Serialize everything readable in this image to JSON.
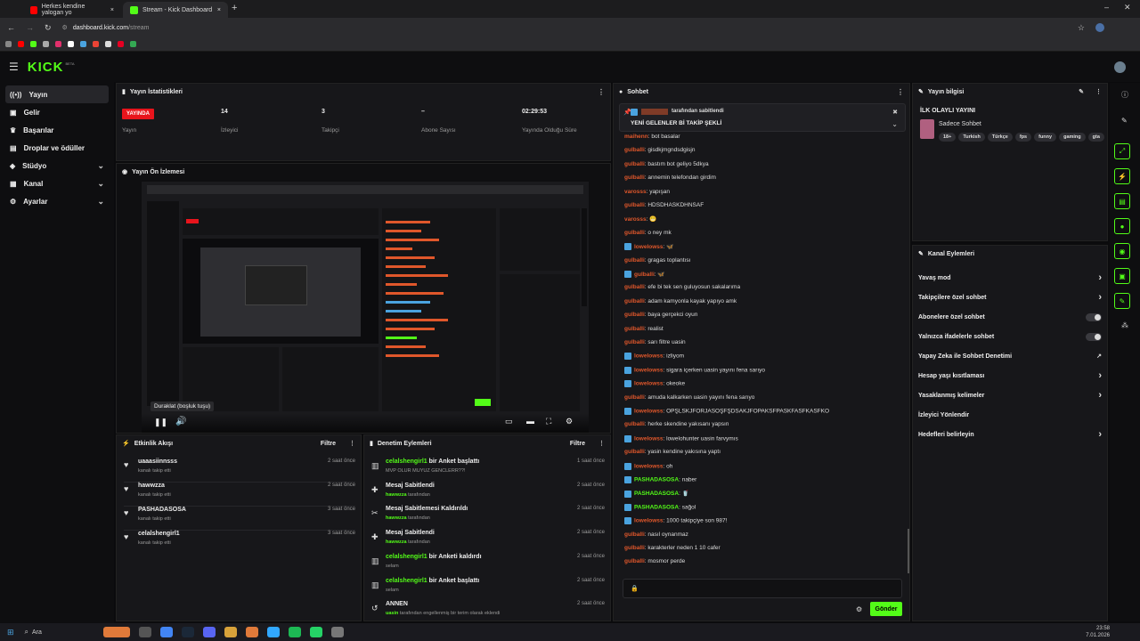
{
  "browser": {
    "tabs": [
      {
        "title": "Herkes kendine yalogan yo",
        "active": false
      },
      {
        "title": "Stream - Kick Dashboard",
        "active": true
      }
    ],
    "url_host": "dashboard.kick.com",
    "url_path": "/stream"
  },
  "app": {
    "logo": "KICK",
    "logo_tag": "BETA",
    "accent": "#53fc18",
    "live_color": "#e8141c"
  },
  "sidebar": {
    "items": [
      {
        "label": "Yayın",
        "icon": "broadcast-icon",
        "active": true,
        "expand": false
      },
      {
        "label": "Gelir",
        "icon": "wallet-icon",
        "active": false,
        "expand": false
      },
      {
        "label": "Başarılar",
        "icon": "trophy-icon",
        "active": false,
        "expand": false
      },
      {
        "label": "Droplar ve ödüller",
        "icon": "gift-icon",
        "active": false,
        "expand": false
      },
      {
        "label": "Stüdyo",
        "icon": "studio-icon",
        "active": false,
        "expand": true
      },
      {
        "label": "Kanal",
        "icon": "channel-icon",
        "active": false,
        "expand": true
      },
      {
        "label": "Ayarlar",
        "icon": "gear-icon",
        "active": false,
        "expand": true
      }
    ]
  },
  "stats": {
    "title": "Yayın İstatistikleri",
    "live_badge": "YAYINDA",
    "items": [
      {
        "value": "",
        "label": "Yayın"
      },
      {
        "value": "14",
        "label": "İzleyici"
      },
      {
        "value": "3",
        "label": "Takipçi"
      },
      {
        "value": "–",
        "label": "Abone Sayısı"
      },
      {
        "value": "02:29:53",
        "label": "Yayında Olduğu Süre"
      }
    ]
  },
  "preview": {
    "title": "Yayın Ön İzlemesi",
    "tooltip": "Duraklat (boşluk tuşu)"
  },
  "events": {
    "title": "Etkinlik Akışı",
    "filter": "Filtre",
    "items": [
      {
        "name": "uaaasiinnsss",
        "sub": "kanalı takip etti",
        "time": "2 saat önce"
      },
      {
        "name": "hawwzza",
        "sub": "kanalı takip etti",
        "time": "2 saat önce"
      },
      {
        "name": "PASHADASOSA",
        "sub": "kanalı takip etti",
        "time": "3 saat önce"
      },
      {
        "name": "celalshengirl1",
        "sub": "kanalı takip etti",
        "time": "3 saat önce"
      }
    ]
  },
  "moderation": {
    "title": "Denetim Eylemleri",
    "filter": "Filtre",
    "items": [
      {
        "icon": "poll-icon",
        "user": "celalshengirl1",
        "action": " bir Anket başlattı",
        "sub_user": "",
        "sub": "MVP OLUR MUYUZ GENCLERR??!",
        "time": "1 saat önce"
      },
      {
        "icon": "pin-icon",
        "user": "",
        "action": "Mesaj Sabitlendi",
        "sub_user": "hawwzza",
        "sub": " tarafından",
        "time": "2 saat önce"
      },
      {
        "icon": "unpin-icon",
        "user": "",
        "action": "Mesaj Sabitlemesi Kaldırıldı",
        "sub_user": "hawwzza",
        "sub": " tarafından",
        "time": "2 saat önce"
      },
      {
        "icon": "pin-icon",
        "user": "",
        "action": "Mesaj Sabitlendi",
        "sub_user": "hawwzza",
        "sub": " tarafından",
        "time": "2 saat önce"
      },
      {
        "icon": "poll-icon",
        "user": "celalshengirl1",
        "action": " bir Anketi kaldırdı",
        "sub_user": "",
        "sub": "selam",
        "time": "2 saat önce"
      },
      {
        "icon": "poll-icon",
        "user": "celalshengirl1",
        "action": " bir Anket başlattı",
        "sub_user": "",
        "sub": "selam",
        "time": "2 saat önce"
      },
      {
        "icon": "history-icon",
        "user": "",
        "action": "ANNEN",
        "sub_user": "uasin",
        "sub": " tarafından engellenmiş bir terim olarak eklendi",
        "time": "2 saat önce"
      }
    ]
  },
  "chat": {
    "title": "Sohbet",
    "pinned_by": "tarafından sabitlendi",
    "pinned_text": "YENİ GELENLER Bİ TAKİP ŞEKLİ",
    "send": "Gönder",
    "messages": [
      {
        "user": "maihenn",
        "color": "#e0572b",
        "text": ": bot basalar",
        "badge": false
      },
      {
        "user": "gulballi",
        "color": "#e0572b",
        "text": ": gisdkjmgndsdgisjn",
        "badge": false
      },
      {
        "user": "gulballi",
        "color": "#e0572b",
        "text": ": bastım bot geliyo 5dkya",
        "badge": false
      },
      {
        "user": "gulballi",
        "color": "#e0572b",
        "text": ": annemin telefondan girdim",
        "badge": false
      },
      {
        "user": "varosss",
        "color": "#e0572b",
        "text": ": yapışan",
        "badge": false
      },
      {
        "user": "gulballi",
        "color": "#e0572b",
        "text": ": HDSDHASKDHNSAF",
        "badge": false
      },
      {
        "user": "varosss",
        "color": "#e0572b",
        "text": ": 😬",
        "badge": false
      },
      {
        "user": "gulballi",
        "color": "#e0572b",
        "text": ": o ney mk",
        "badge": false
      },
      {
        "user": "lowelowss",
        "color": "#e0572b",
        "text": ": 🦋",
        "badge": true
      },
      {
        "user": "gulballi",
        "color": "#e0572b",
        "text": ": gragas toplantısı",
        "badge": false
      },
      {
        "user": "gulballi",
        "color": "#e0572b",
        "text": ": 🦋",
        "badge": true
      },
      {
        "user": "gulballi",
        "color": "#e0572b",
        "text": ": efe bi tek sen guluyosun sakalarıma",
        "badge": false
      },
      {
        "user": "gulballi",
        "color": "#e0572b",
        "text": ": adam kamyonla kayak yapıyo amk",
        "badge": false
      },
      {
        "user": "gulballi",
        "color": "#e0572b",
        "text": ": baya gerçekci oyun",
        "badge": false
      },
      {
        "user": "gulballi",
        "color": "#e0572b",
        "text": ": realist",
        "badge": false
      },
      {
        "user": "gulballi",
        "color": "#e0572b",
        "text": ": sarı filtre uasin",
        "badge": false
      },
      {
        "user": "lowelowss",
        "color": "#e0572b",
        "text": ": izliyom",
        "badge": true
      },
      {
        "user": "lowelowss",
        "color": "#e0572b",
        "text": ": sigara içerken uasin yayını fena sarıyo",
        "badge": true
      },
      {
        "user": "lowelowss",
        "color": "#e0572b",
        "text": ": okeoke",
        "badge": true
      },
      {
        "user": "gulballi",
        "color": "#e0572b",
        "text": ": amuda kalkarken uasin yayını fena sarıyo",
        "badge": false
      },
      {
        "user": "lowelowss",
        "color": "#e0572b",
        "text": ": OPŞLSKJFORJASOŞFŞDSAKJFOPAKSFPASKFASFKASFKO",
        "badge": true
      },
      {
        "user": "gulballi",
        "color": "#e0572b",
        "text": ": herke skendine yakısanı yapsın",
        "badge": false
      },
      {
        "user": "lowelowss",
        "color": "#e0572b",
        "text": ": lowelohunter uasin farvymıs",
        "badge": true
      },
      {
        "user": "gulballi",
        "color": "#e0572b",
        "text": ": yasin kendine yakısına yaptı",
        "badge": false
      },
      {
        "user": "lowelowss",
        "color": "#e0572b",
        "text": ": oh",
        "badge": true
      },
      {
        "user": "PASHADASOSA",
        "color": "#53fc18",
        "text": ": naber",
        "badge": true
      },
      {
        "user": "PASHADASOSA",
        "color": "#53fc18",
        "text": ": 🥤",
        "badge": true
      },
      {
        "user": "PASHADASOSA",
        "color": "#53fc18",
        "text": ": sağol",
        "badge": true
      },
      {
        "user": "lowelowss",
        "color": "#e0572b",
        "text": ": 1000 takipçiye son 987!",
        "badge": true
      },
      {
        "user": "gulballi",
        "color": "#e0572b",
        "text": ": nasıl oynanmaz",
        "badge": false
      },
      {
        "user": "gulballi",
        "color": "#e0572b",
        "text": ": karakterler neden 1 10 cafer",
        "badge": false
      },
      {
        "user": "gulballi",
        "color": "#e0572b",
        "text": ": mosmor perde",
        "badge": false
      }
    ]
  },
  "stream_info": {
    "title": "Yayın bilgisi",
    "stream_title": "İLK OLAYLI YAYINI",
    "category": "Sadece Sohbet",
    "tags": [
      "18+",
      "Turkish",
      "Türkçe",
      "fps",
      "funny",
      "gaming",
      "gta"
    ]
  },
  "channel_actions": {
    "title": "Kanal Eylemleri",
    "items": [
      {
        "label": "Yavaş mod",
        "control": "chevron"
      },
      {
        "label": "Takipçilere özel sohbet",
        "control": "chevron"
      },
      {
        "label": "Abonelere özel sohbet",
        "control": "toggle"
      },
      {
        "label": "Yalnızca ifadelerle sohbet",
        "control": "toggle"
      },
      {
        "label": "Yapay Zeka ile Sohbet Denetimi",
        "control": "external"
      },
      {
        "label": "Hesap yaşı kısıtlaması",
        "control": "chevron"
      },
      {
        "label": "Yasaklanmış kelimeler",
        "control": "chevron"
      },
      {
        "label": "İzleyici Yönlendir",
        "control": "none"
      },
      {
        "label": "Hedefleri belirleyin",
        "control": "chevron"
      }
    ]
  },
  "taskbar": {
    "search": "Ara",
    "time": "23:58",
    "date": "7.01.2026"
  }
}
